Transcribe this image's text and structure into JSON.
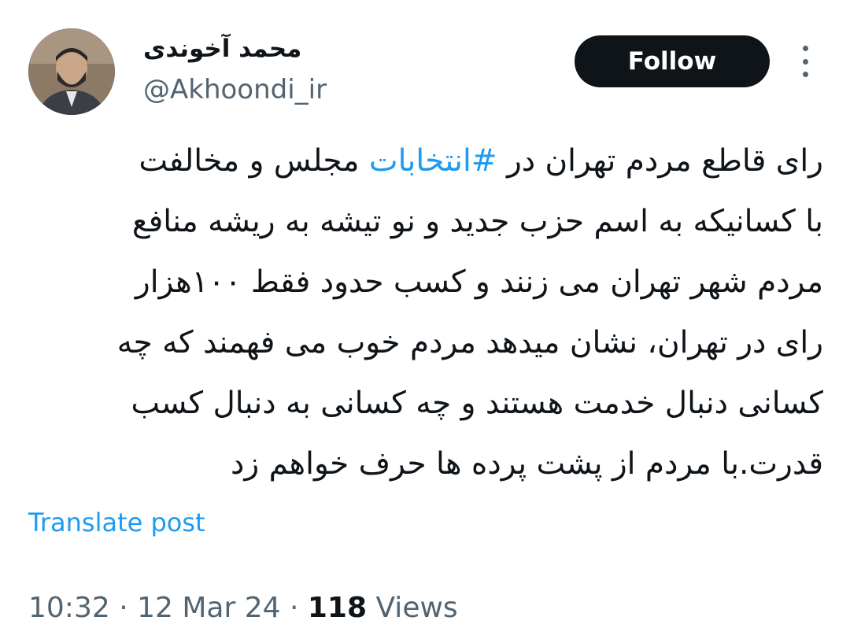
{
  "author": {
    "display_name": "محمد آخوندی",
    "handle": "@Akhoondi_ir",
    "avatar_icon": "profile-photo"
  },
  "actions": {
    "follow_label": "Follow",
    "more_icon": "more-vertical-icon"
  },
  "tweet": {
    "lines": [
      {
        "before": "رای قاطع مردم تهران در ",
        "hashtag": "#انتخابات",
        "after": " مجلس و مخالفت"
      },
      {
        "text": "با کسانیکه به اسم حزب جدید و نو تیشه به ریشه منافع"
      },
      {
        "text": "مردم شهر تهران می زنند و کسب حدود فقط ۱۰۰هزار"
      },
      {
        "text": "رای در تهران، نشان میدهد مردم خوب می فهمند که چه"
      },
      {
        "text": "کسانی دنبال خدمت هستند و چه کسانی به دنبال کسب"
      },
      {
        "text": "قدرت.با مردم از پشت پرده ها حرف خواهم زد"
      }
    ]
  },
  "translate_label": "Translate post",
  "meta": {
    "time": "10:32",
    "sep1": " · ",
    "date": "12 Mar 24",
    "sep2": " · ",
    "views_count": "118",
    "views_label": " Views"
  },
  "colors": {
    "link": "#1d9bf0",
    "text": "#0f1419",
    "secondary": "#536471",
    "button_bg": "#0f1419"
  }
}
